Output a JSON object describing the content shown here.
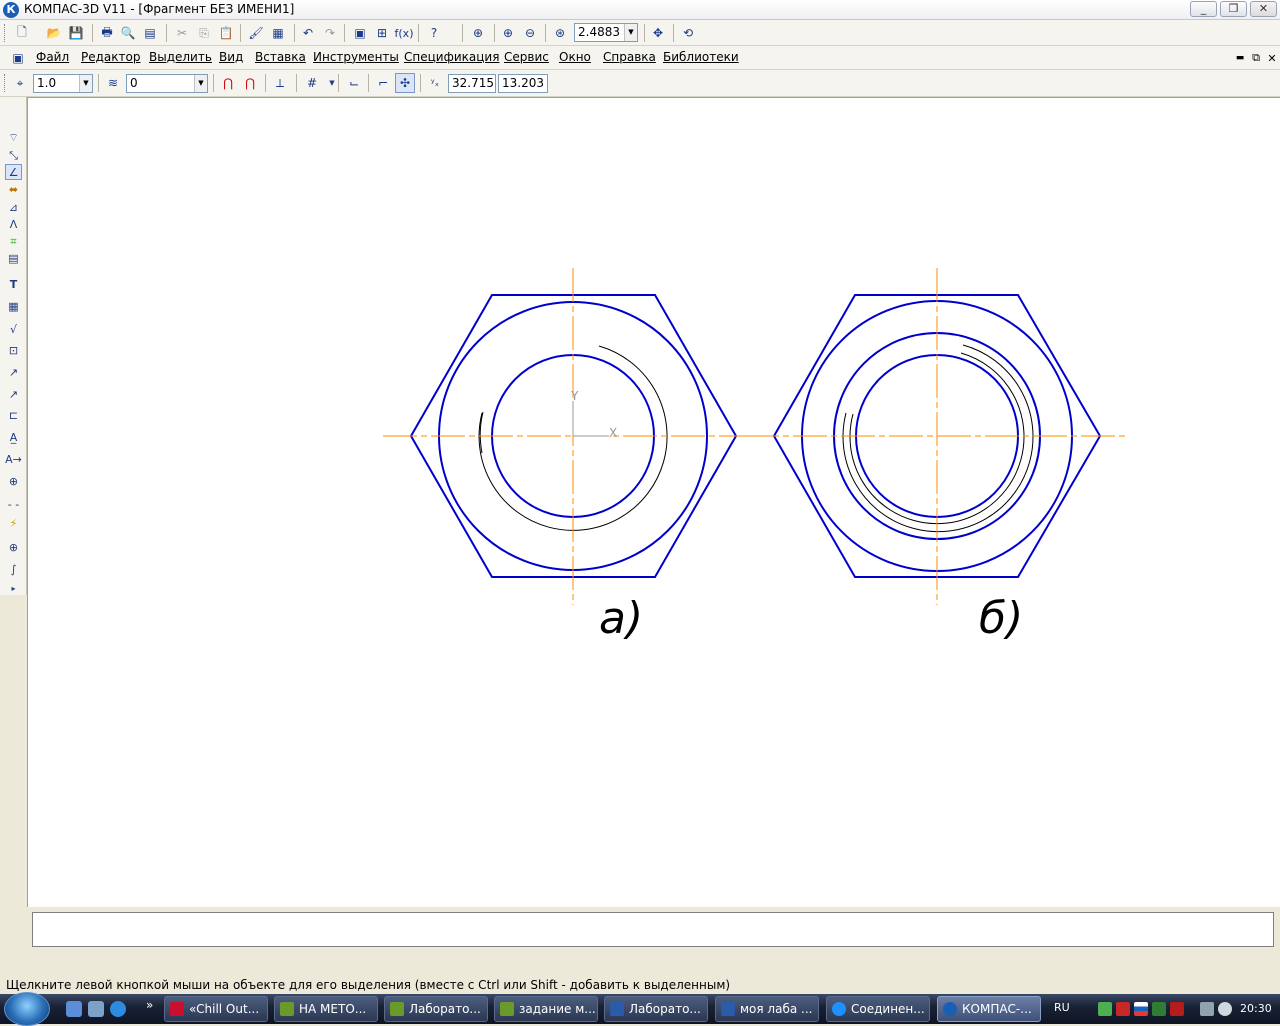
{
  "window": {
    "title": "КОМПАС-3D V11 - [Фрагмент БЕЗ ИМЕНИ1]",
    "app_icon_letter": "К",
    "minimize": "_",
    "maximize": "❐",
    "close": "✕"
  },
  "menu": {
    "items": [
      "Файл",
      "Редактор",
      "Выделить",
      "Вид",
      "Вставка",
      "Инструменты",
      "Спецификация",
      "Сервис",
      "Окно",
      "Справка",
      "Библиотеки"
    ],
    "doc_controls": [
      "▬",
      "⧉",
      "✕"
    ]
  },
  "toolbar_standard": {
    "zoom_value": "2.4883"
  },
  "toolbar_current_state": {
    "step_value": "1.0",
    "layer_value": "0",
    "coord_x": "32.715",
    "coord_y": "13.203"
  },
  "drawing": {
    "label_a": "а)",
    "label_b": "б)",
    "axis_x_label": "X",
    "axis_y_label": "Y",
    "colors": {
      "outline": "#0000cc",
      "axis": "#ff8c00",
      "thread": "#000000"
    }
  },
  "status_bar": {
    "hint": "Щелкните левой кнопкой мыши на объекте для его выделения (вместе с Ctrl или Shift - добавить к выделенным)"
  },
  "taskbar": {
    "items": [
      {
        "label": "«Chill Out...",
        "color": "#c8102e"
      },
      {
        "label": "НА МЕТО...",
        "color": "#6a9a2a"
      },
      {
        "label": "Лаборато...",
        "color": "#6a9a2a"
      },
      {
        "label": "задание м...",
        "color": "#6a9a2a"
      },
      {
        "label": "Лаборато...",
        "color": "#2b5cab"
      },
      {
        "label": "моя лаба ...",
        "color": "#2b5cab"
      },
      {
        "label": "Соединен...",
        "color": "#1e90ff"
      },
      {
        "label": "КОМПАС-...",
        "color": "#1b5fb5"
      }
    ],
    "language": "RU",
    "time": "20:30",
    "overflow": "»"
  }
}
